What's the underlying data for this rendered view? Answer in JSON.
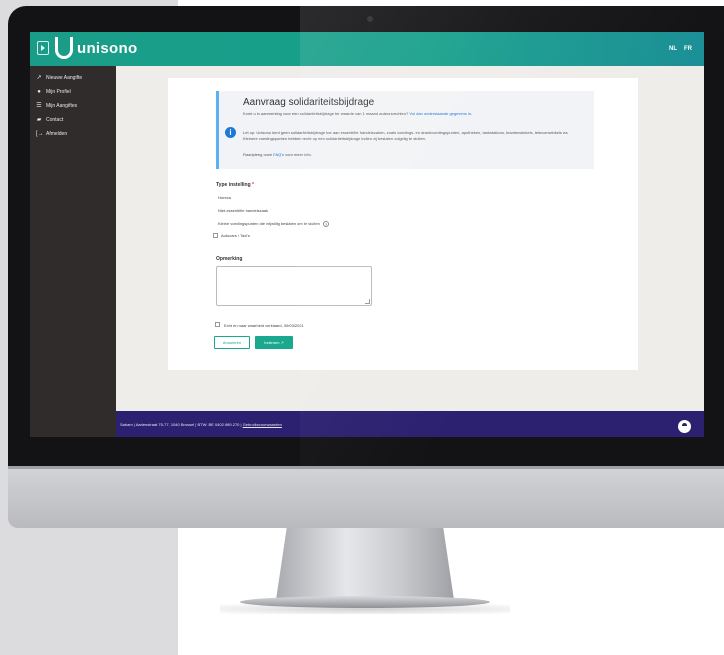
{
  "app": {
    "logo_text": "unisono",
    "languages": [
      "NL",
      "FR"
    ]
  },
  "sidebar": {
    "items": [
      {
        "icon": "rocket-icon",
        "glyph": "↗",
        "label": "Nieuwe Aangifte"
      },
      {
        "icon": "user-icon",
        "glyph": "●",
        "label": "Mijn Profiel"
      },
      {
        "icon": "list-icon",
        "glyph": "☰",
        "label": "Mijn Aangiftes"
      },
      {
        "icon": "chat-icon",
        "glyph": "▰",
        "label": "Contact"
      },
      {
        "icon": "logout-icon",
        "glyph": "[→",
        "label": "Afmelden"
      }
    ]
  },
  "info": {
    "title": "Aanvraag solidariteitsbijdrage",
    "sub_prefix": "Komt u in aanmerking voor een solidariteitsbijdrage ter waarde van 1 maand auteursrechten?",
    "sub_link": "Vul dan onderstaande gegevens in.",
    "p1": "Let op: Unisono kent geen solidariteitsbijdrage toe aan essentiële handelszaken, zoals voedings- en drankvoedingspunten, apotheken, tankstations, krantenwinkels, telecomwinkels ea. Kleinere voedingspunten hebben recht op een solidariteitsbijdrage indien zij beslaten volgelig te sluiten.",
    "p2_prefix": "Raadpleeg onze",
    "p2_link": "FAQ's",
    "p2_suffix": "voor meer info."
  },
  "form": {
    "type_label": "Type instelling",
    "required_mark": "*",
    "options": [
      "Horeca",
      "Niet-essentiële handelszaak",
      "Kleine voedingspunten die vrijwillig beslaten om te sluiten",
      "Autocars / Taxi's"
    ],
    "help_glyph": "?",
    "remark_label": "Opmerking",
    "consent": "Echt en naar waarheid verklaard, 30/03/2021",
    "cancel_label": "Annuleren",
    "submit_label": "Indienen ↗"
  },
  "footer": {
    "text": "Sabam | Aarlenstraat 75-77, 1040 Brussel | BTW: BE 0402.989.270 |",
    "link": "Gebruiksvoorwaarden"
  },
  "colors": {
    "accent": "#1aa88f",
    "sidebar": "#2f2c2b",
    "footer": "#2b2170",
    "info_icon": "#1e78d6"
  }
}
